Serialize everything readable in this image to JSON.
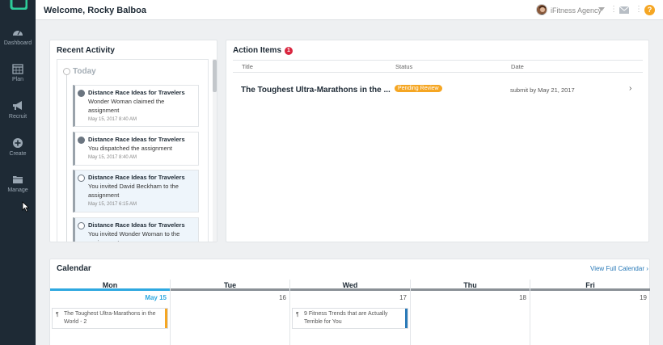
{
  "topbar": {
    "welcome": "Welcome, Rocky Balboa",
    "agency": "iFitness Agency",
    "separator": "⋮",
    "help": "?"
  },
  "sidebar": {
    "items": [
      {
        "label": "Dashboard",
        "icon": "dashboard-icon"
      },
      {
        "label": "Plan",
        "icon": "calendar-icon"
      },
      {
        "label": "Recruit",
        "icon": "megaphone-icon"
      },
      {
        "label": "Create",
        "icon": "plus-circle-icon"
      },
      {
        "label": "Manage",
        "icon": "folder-icon"
      }
    ]
  },
  "recent_activity": {
    "title": "Recent Activity",
    "today": "Today",
    "items": [
      {
        "title": "Distance Race Ideas for Travelers",
        "text": "Wonder Woman claimed the assignment",
        "time": "May 15, 2017 8:40 AM"
      },
      {
        "title": "Distance Race Ideas for Travelers",
        "text": "You dispatched the assignment",
        "time": "May 15, 2017 8:40 AM"
      },
      {
        "title": "Distance Race Ideas for Travelers",
        "text": "You invited David Beckham to the assignment",
        "time": "May 15, 2017 6:15 AM"
      },
      {
        "title": "Distance Race Ideas for Travelers",
        "text": "You invited Wonder Woman to the assignment",
        "time": ""
      }
    ]
  },
  "action_items": {
    "title": "Action Items",
    "count": "1",
    "columns": [
      "Title",
      "Status",
      "Date"
    ],
    "rows": [
      {
        "title": "The Toughest Ultra-Marathons in the ...",
        "status": "Pending Review",
        "date": "submit by May 21, 2017",
        "chevron": "›"
      }
    ]
  },
  "calendar": {
    "title": "Calendar",
    "link": "View Full Calendar ›",
    "days": [
      {
        "name": "Mon",
        "date": "May 15",
        "today": true
      },
      {
        "name": "Tue",
        "date": "16"
      },
      {
        "name": "Wed",
        "date": "17"
      },
      {
        "name": "Thu",
        "date": "18"
      },
      {
        "name": "Fri",
        "date": "19"
      }
    ],
    "events": [
      {
        "text": "The Toughest Ultra-Marathons in the World - 2",
        "color": "#f5a623",
        "icon": "¶"
      },
      {
        "text": "9 Fitness Trends that are Actually Terrible for You",
        "color": "#2a7ab8",
        "icon": "¶"
      }
    ]
  },
  "colors": {
    "sidebar_bg": "#1e2a35",
    "accent_blue": "#2ea8e0",
    "badge_red": "#d9263f",
    "pending_orange": "#f5a623"
  }
}
